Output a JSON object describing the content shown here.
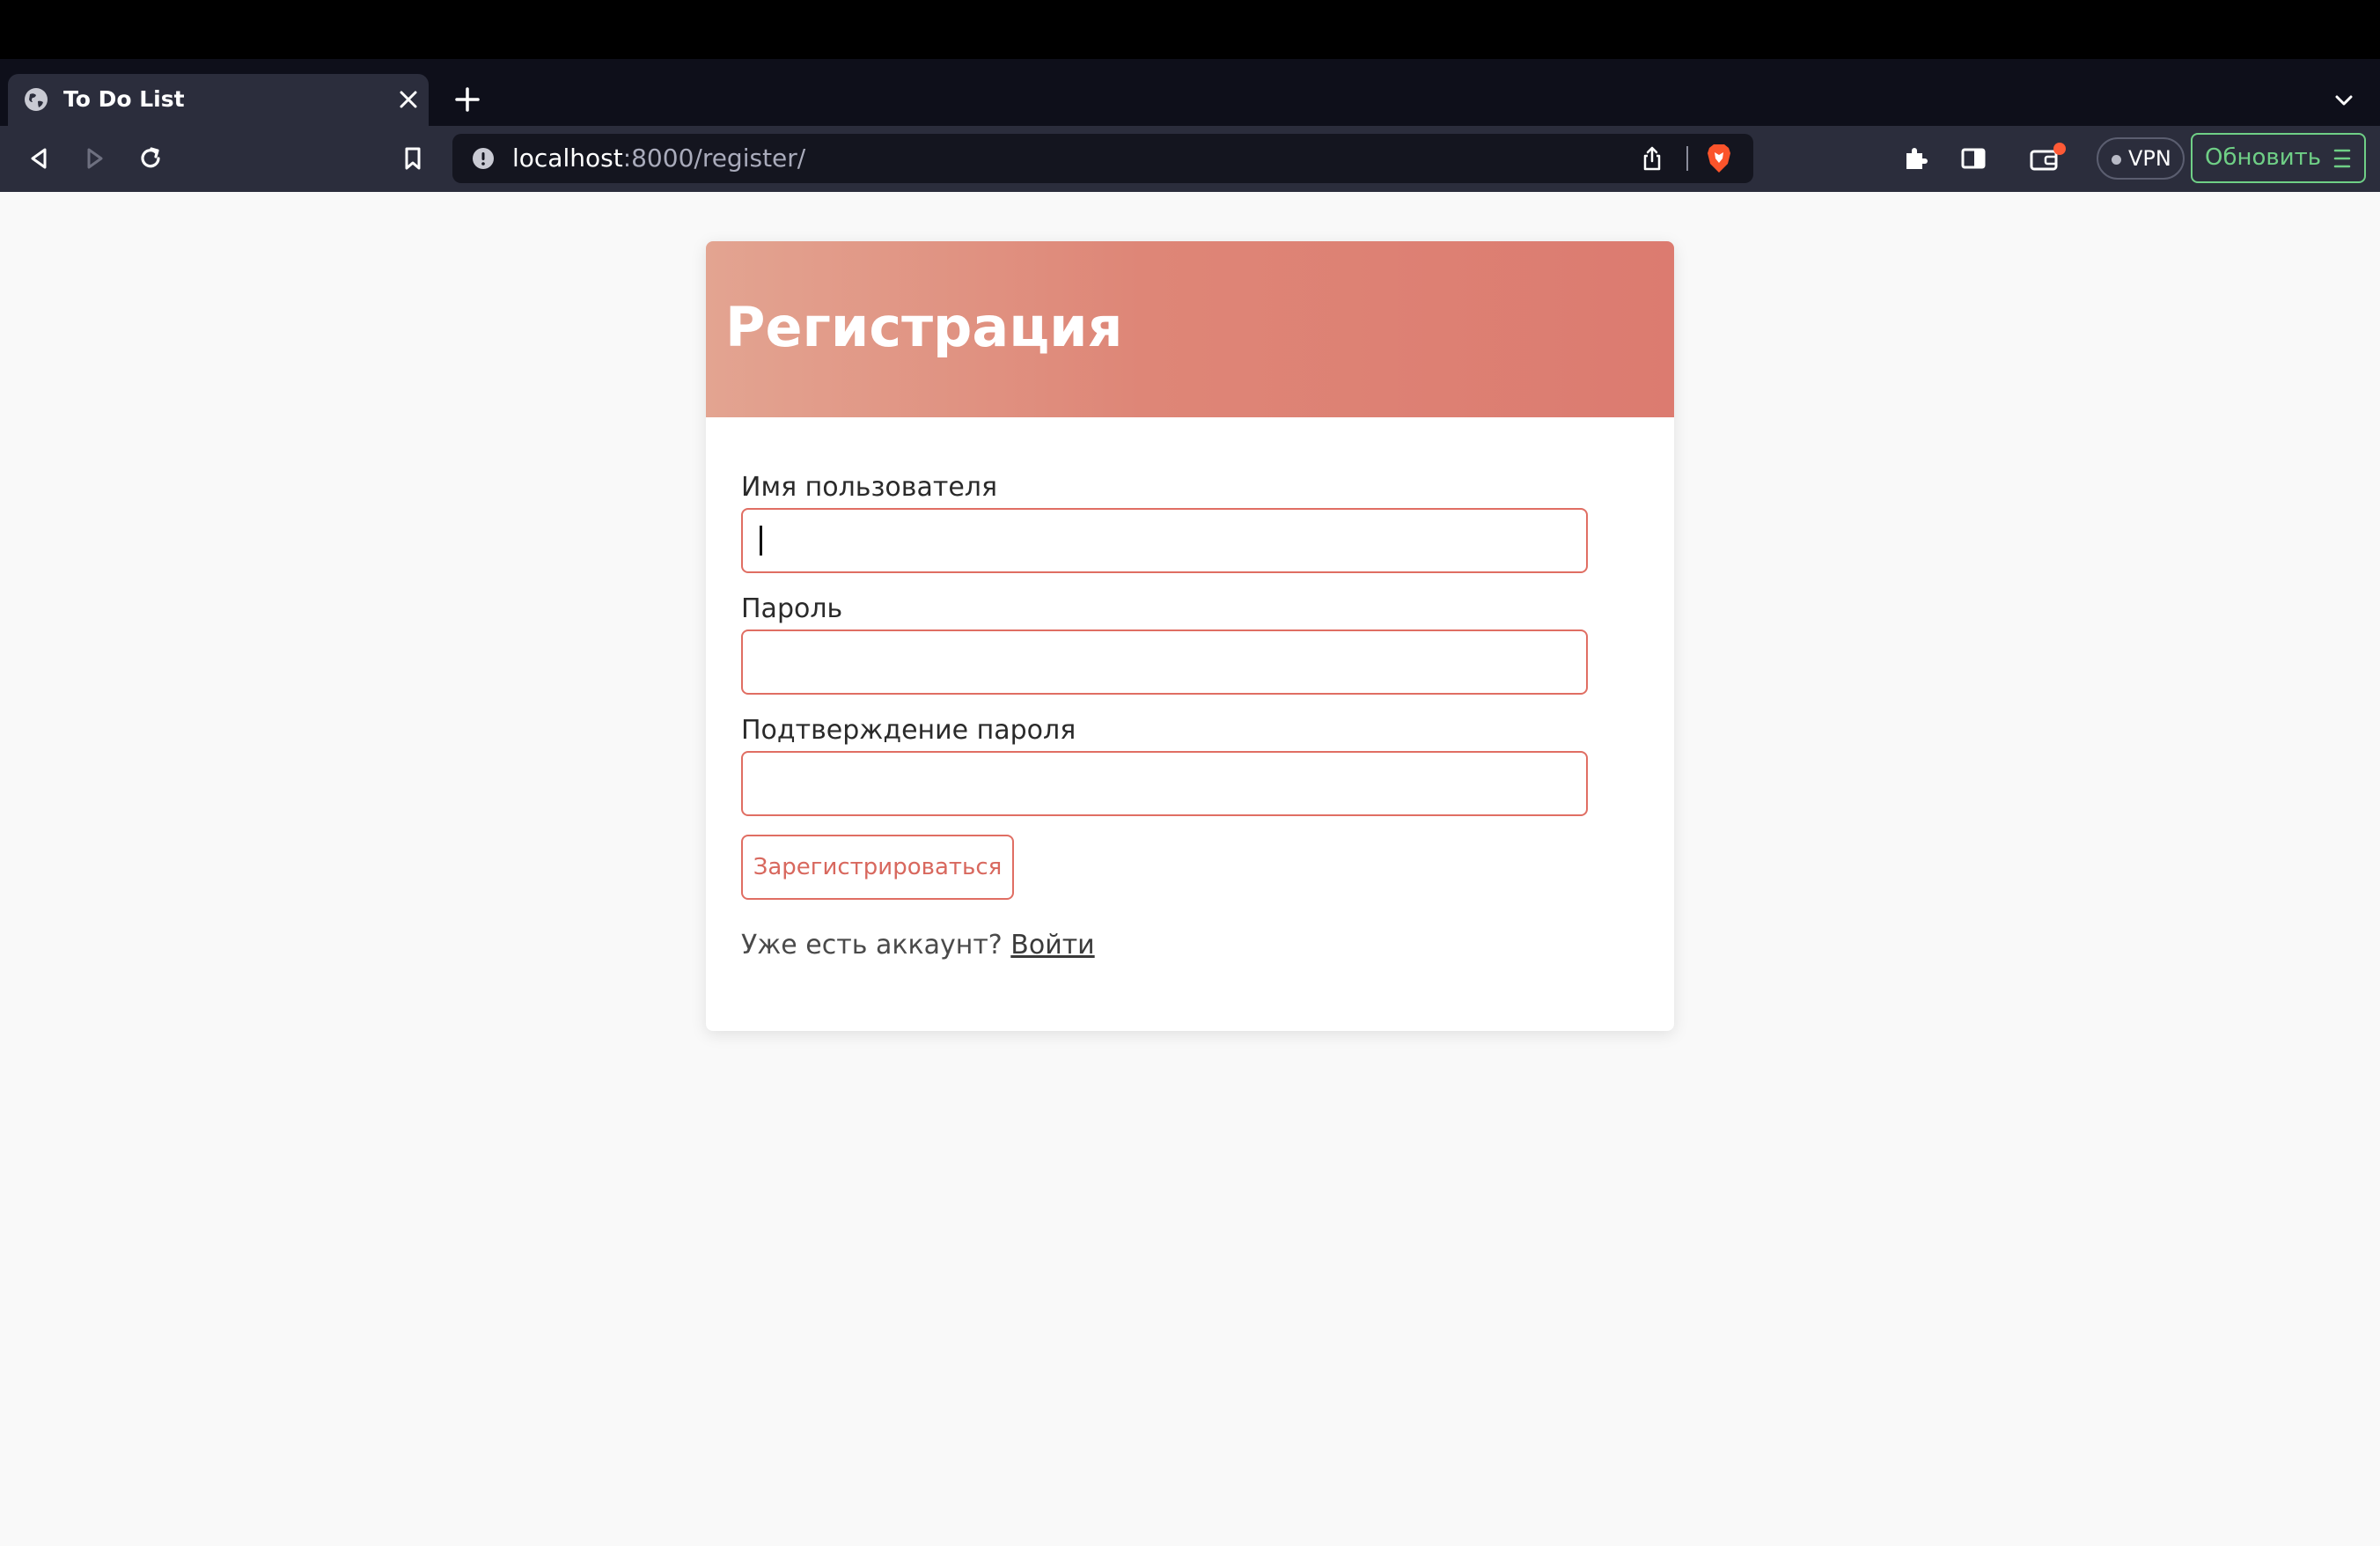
{
  "browser": {
    "tab": {
      "title": "To Do List"
    },
    "address": {
      "host": "localhost",
      "rest": ":8000/register/"
    },
    "vpn_label": "VPN",
    "update_label": "Обновить",
    "colors": {
      "update_green": "#6fcf86",
      "notification_dot": "#ff5a36"
    }
  },
  "page": {
    "title": "Регистрация",
    "fields": [
      {
        "label": "Имя пользователя",
        "value": ""
      },
      {
        "label": "Пароль",
        "value": ""
      },
      {
        "label": "Подтверждение пароля",
        "value": ""
      }
    ],
    "submit_label": "Зарегистрироваться",
    "login_prompt": "Уже есть аккаунт?",
    "login_link": "Войти",
    "colors": {
      "accent": "#e06e63",
      "header_gradient_start": "#e3a491",
      "header_gradient_end": "#dc7b70"
    }
  }
}
